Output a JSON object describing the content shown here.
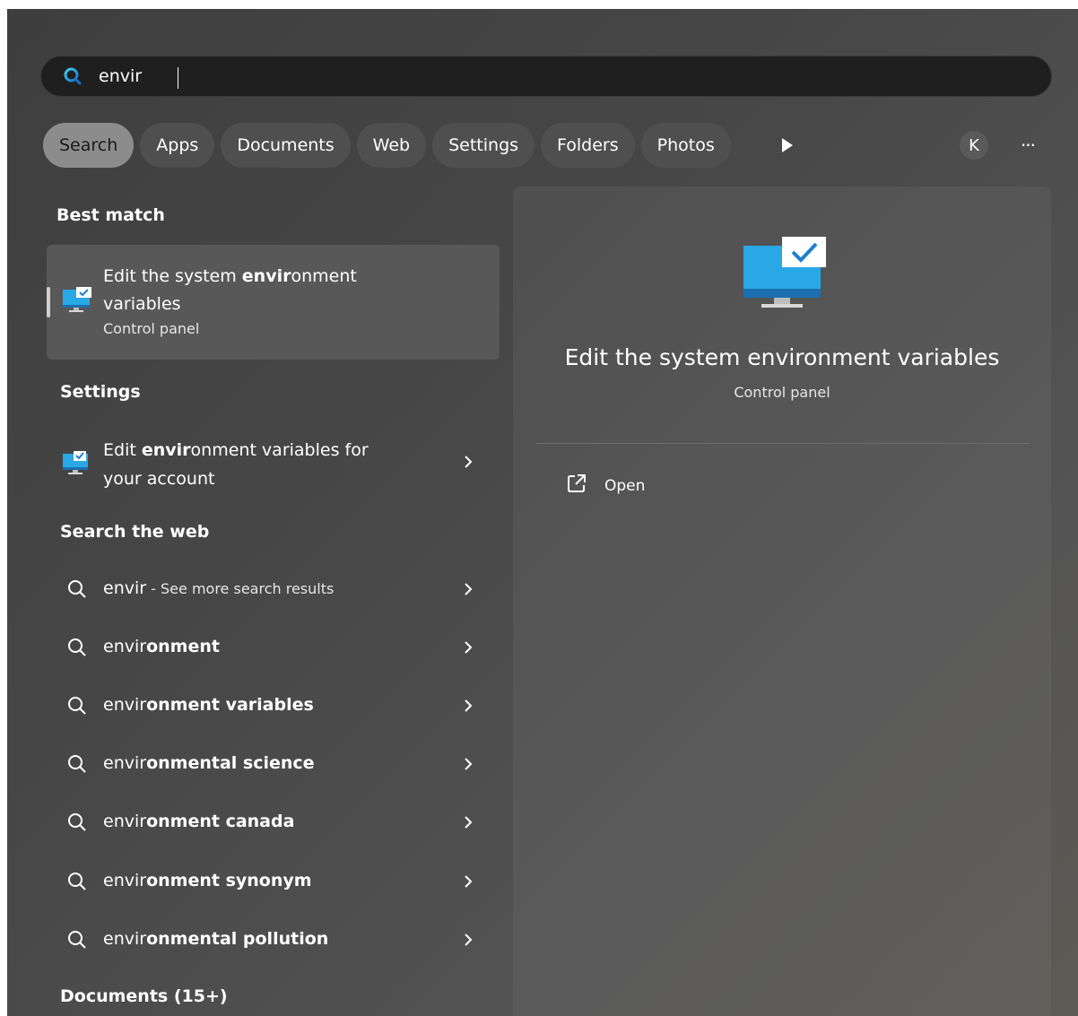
{
  "search": {
    "value": "envir",
    "placeholder": ""
  },
  "tabs": [
    {
      "label": "Search",
      "active": true
    },
    {
      "label": "Apps"
    },
    {
      "label": "Documents"
    },
    {
      "label": "Web"
    },
    {
      "label": "Settings"
    },
    {
      "label": "Folders"
    },
    {
      "label": "Photos"
    }
  ],
  "avatar_initial": "K",
  "more_label": "···",
  "best_match": {
    "heading": "Best match",
    "title_pre": "Edit the system ",
    "title_bold": "envir",
    "title_post": "onment variables",
    "subtitle": "Control panel"
  },
  "settings": {
    "heading": "Settings",
    "item_pre": "Edit ",
    "item_bold": "envir",
    "item_post": "onment variables for your account"
  },
  "web": {
    "heading": "Search the web",
    "first": {
      "query": "envir",
      "hint": " - See more search results"
    },
    "items": [
      {
        "pre": "envir",
        "post": "onment"
      },
      {
        "pre": "envir",
        "post": "onment variables"
      },
      {
        "pre": "envir",
        "post": "onmental science"
      },
      {
        "pre": "envir",
        "post": "onment canada"
      },
      {
        "pre": "envir",
        "post": "onment synonym"
      },
      {
        "pre": "envir",
        "post": "onmental pollution"
      }
    ]
  },
  "documents_heading": "Documents (15+)",
  "detail": {
    "title": "Edit the system environment variables",
    "subtitle": "Control panel",
    "open_label": "Open"
  },
  "icons": {
    "search": "search-icon",
    "monitor": "monitor-check-icon",
    "chevron": "chevron-right-icon",
    "open": "open-external-icon",
    "play": "play-icon"
  },
  "colors": {
    "accent_blue": "#1e9be0",
    "tab_active": "#8c8c8c"
  }
}
